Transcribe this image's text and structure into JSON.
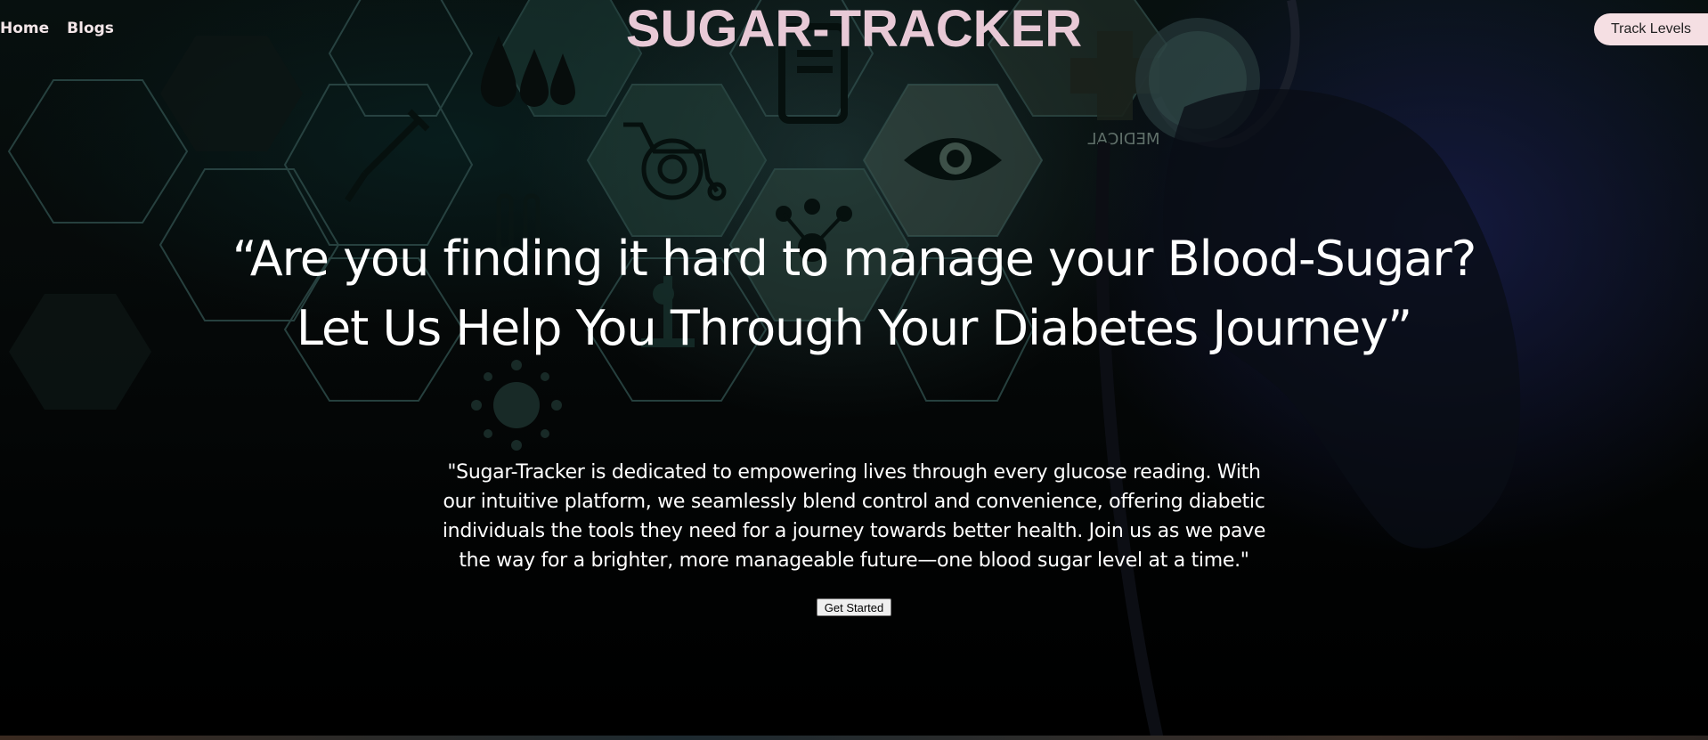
{
  "nav": {
    "links": [
      {
        "label": "Home"
      },
      {
        "label": "Blogs"
      }
    ],
    "track_button_label": "Track Levels"
  },
  "brand": {
    "title": "SUGAR-TRACKER"
  },
  "hero": {
    "headline_line1": "“Are you finding it hard to manage your Blood-Sugar?",
    "headline_line2": "Let Us Help You Through Your Diabetes Journey”",
    "description": "\"Sugar-Tracker is dedicated to empowering lives through every glucose reading. With our intuitive platform, we seamlessly blend control and convenience, offering diabetic individuals the tools they need for a journey towards better health. Join us as we pave the way for a brighter, more manageable future—one blood sugar level at a time.\"",
    "cta_label": "Get Started"
  },
  "background": {
    "medical_sign_text": "MEDICAL",
    "icons": [
      "blood-drops-icon",
      "syringe-icon",
      "document-icon",
      "wheelchair-icon",
      "eye-icon",
      "molecule-icon",
      "test-tubes-icon",
      "microscope-icon",
      "cross-icon",
      "virus-icon",
      "stethoscope-icon"
    ]
  },
  "colors": {
    "brand": "#e8c9d6",
    "track_button_bg": "#f5dfe3",
    "text": "#ffffff",
    "nav_text": "#f3e6e8"
  }
}
